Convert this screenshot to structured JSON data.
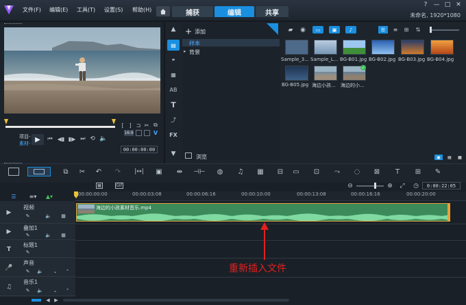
{
  "menu": [
    {
      "label": "文件(F)"
    },
    {
      "label": "编辑(E)"
    },
    {
      "label": "工具(T)"
    },
    {
      "label": "设置(S)"
    },
    {
      "label": "帮助(H)"
    }
  ],
  "tabs": [
    {
      "label": "捕获"
    },
    {
      "label": "编辑"
    },
    {
      "label": "共享"
    }
  ],
  "window": {
    "status": "未命名, 1920*1080"
  },
  "preview": {
    "project_label": "项目-",
    "clip_label": "素材-",
    "timecode": "00:00:00:00",
    "ratio": "16:9"
  },
  "library": {
    "add_label": "添加",
    "folders": [
      {
        "label": "样本"
      },
      {
        "label": "背景"
      }
    ],
    "browse_label": "浏览",
    "thumbs": [
      {
        "label": "Sample_3...",
        "color": "#4d6a8a"
      },
      {
        "label": "Sample_L...",
        "color": "#8aa7c4"
      },
      {
        "label": "BG-B01.jpg",
        "color": "#3f8f3a"
      },
      {
        "label": "BG-B02.jpg",
        "color": "#3a78c9"
      },
      {
        "label": "BG-B03.jpg",
        "color": "#d07a2a"
      },
      {
        "label": "BG-B04.jpg",
        "color": "#e06a1a"
      },
      {
        "label": "BG-B05.jpg",
        "color": "#2f4a6a"
      },
      {
        "label": "海边小孩...",
        "color": "#7e98b0"
      },
      {
        "label": "海边的小...",
        "color": "#6c8aa6"
      }
    ]
  },
  "timeline": {
    "timecode": "0:00:22:05",
    "ruler": [
      {
        "label": "00:00:00:00"
      },
      {
        "label": "00:00:03:08"
      },
      {
        "label": "00:00:06:16"
      },
      {
        "label": "00:00:10:00"
      },
      {
        "label": "00:00:13:08"
      },
      {
        "label": "00:00:16:16"
      },
      {
        "label": "00:00:20:00"
      }
    ],
    "tracks": [
      {
        "label": "视频"
      },
      {
        "label": "叠加1"
      },
      {
        "label": "标题1"
      },
      {
        "label": "声音"
      },
      {
        "label": "音乐1"
      }
    ],
    "clip_label": "海边的小孩素材音乐.mp4"
  },
  "annotation": {
    "text": "重新插入文件",
    "color": "#e32020"
  }
}
